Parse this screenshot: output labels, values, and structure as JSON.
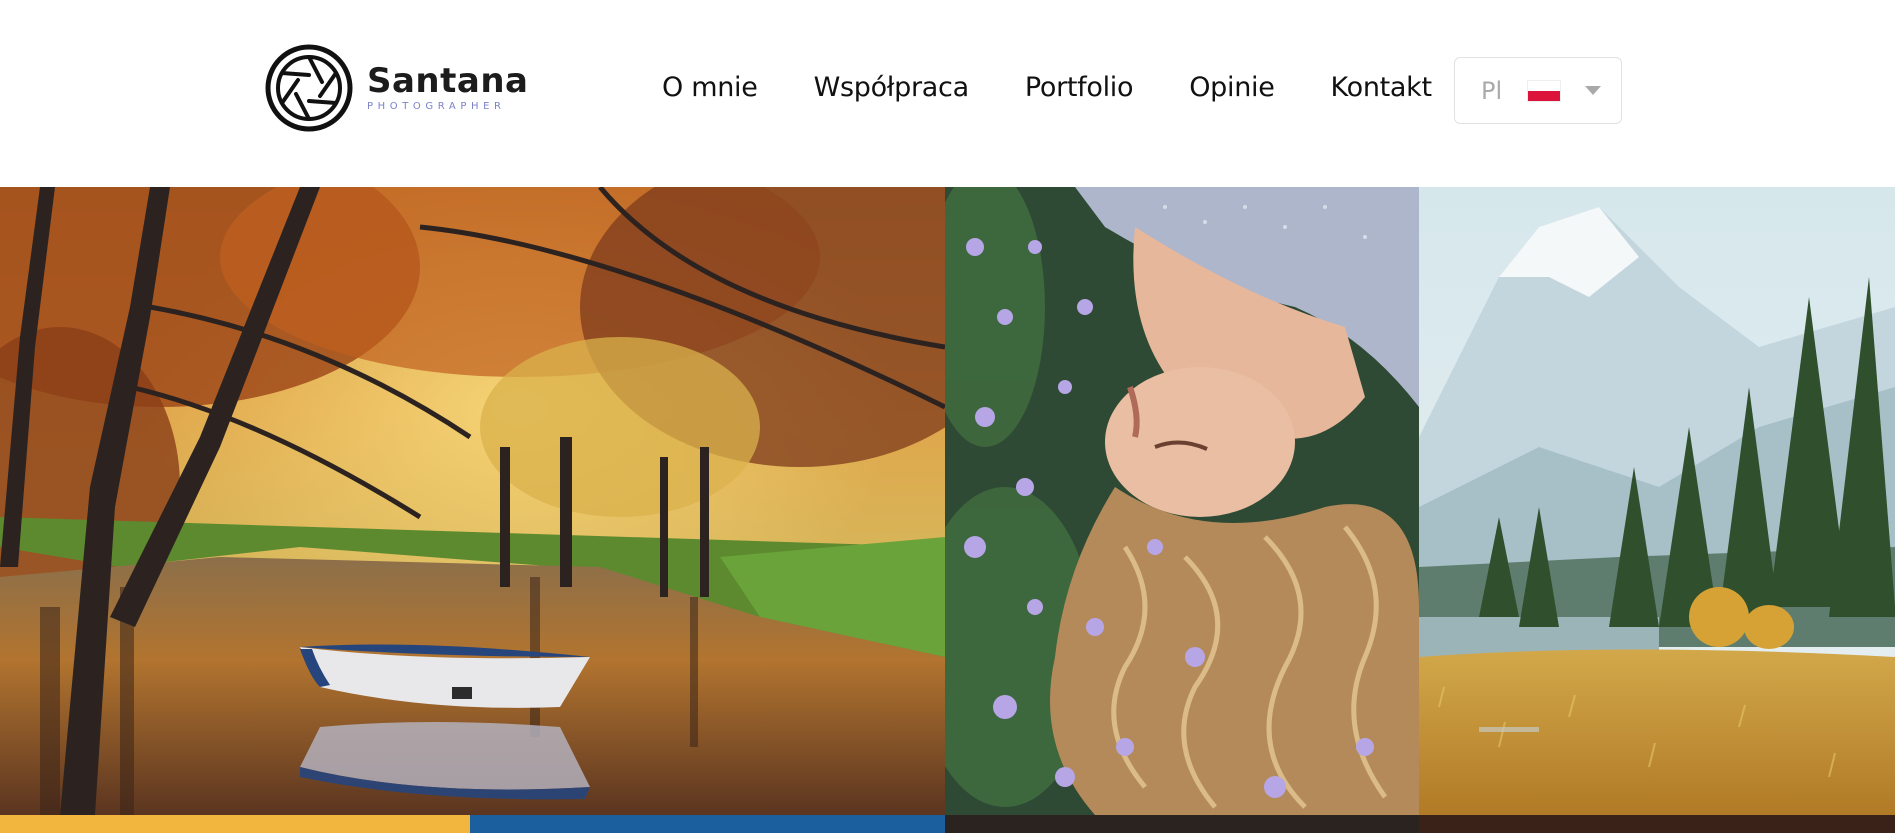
{
  "brand": {
    "name": "Santana",
    "tagline": "PHOTOGRAPHER"
  },
  "nav": {
    "items": [
      "O mnie",
      "Współpraca",
      "Portfolio",
      "Opinie",
      "Kontakt"
    ]
  },
  "language": {
    "code": "Pl",
    "flag_icon": "poland-flag-icon",
    "flag_colors": [
      "#ffffff",
      "#dc143c"
    ]
  },
  "gallery": {
    "tiles": [
      {
        "subject": "autumn-lake-boat"
      },
      {
        "subject": "woman-lying-in-flowers"
      },
      {
        "subject": "mountain-forest-meadow"
      }
    ],
    "bottom_strip_colors": [
      "#f2b63f",
      "#1b5f9e",
      "#2b2320",
      "#3a2218"
    ]
  }
}
